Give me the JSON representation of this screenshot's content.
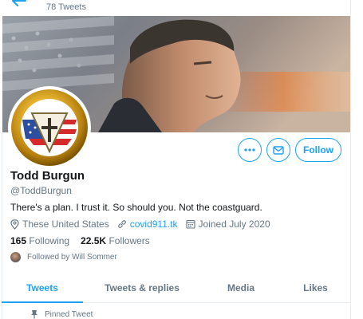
{
  "header": {
    "tweet_count": "78 Tweets"
  },
  "profile": {
    "display_name": "Todd Burgun",
    "handle": "@ToddBurgun",
    "bio": "There's a plan. I trust it. So should you. Not the coastguard.",
    "location": "These United States",
    "website": "covid911.tk",
    "joined": "Joined July 2020",
    "following_count": "165",
    "following_label": "Following",
    "followers_count": "22.5K",
    "followers_label": "Followers",
    "followed_by": "Followed by Will Sommer"
  },
  "actions": {
    "more_icon": "more-icon",
    "message_icon": "envelope-icon",
    "follow_label": "Follow"
  },
  "tabs": [
    {
      "label": "Tweets",
      "active": true
    },
    {
      "label": "Tweets & replies",
      "active": false
    },
    {
      "label": "Media",
      "active": false
    },
    {
      "label": "Likes",
      "active": false
    }
  ],
  "pinned": {
    "label": "Pinned Tweet"
  },
  "colors": {
    "accent": "#1da1f2",
    "muted_text": "#657786",
    "primary_text": "#14171a"
  }
}
